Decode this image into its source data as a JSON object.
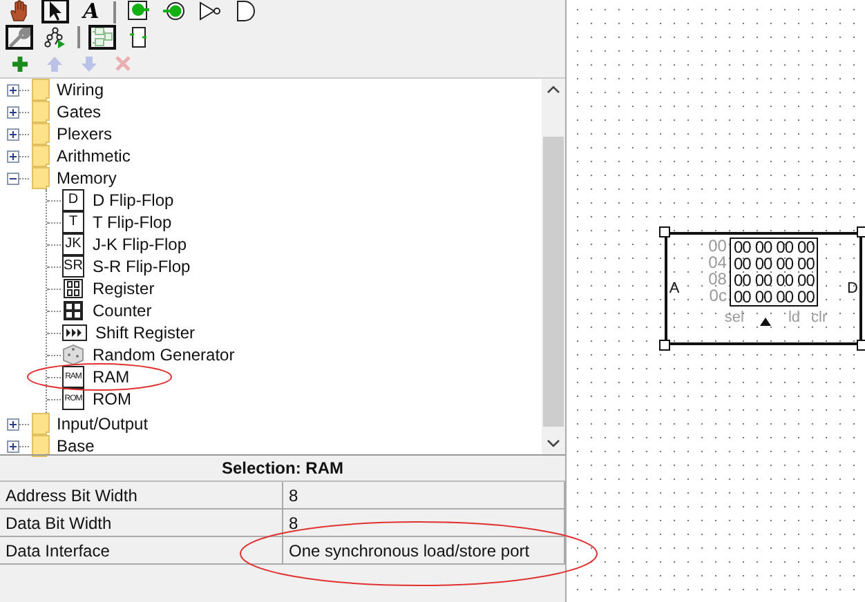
{
  "toolbar": [
    {
      "kind": "hand",
      "selected": false
    },
    {
      "kind": "arrow",
      "selected": true
    },
    {
      "kind": "text",
      "label": "A",
      "selected": false
    },
    {
      "kind": "separator"
    },
    {
      "kind": "input-pin",
      "selected": false
    },
    {
      "kind": "output-pin",
      "selected": false
    },
    {
      "kind": "not-gate",
      "selected": false
    },
    {
      "kind": "and-gate",
      "selected": false
    }
  ],
  "view_toolbar": [
    {
      "kind": "wrench",
      "selected": true
    },
    {
      "kind": "tree",
      "selected": false
    },
    {
      "kind": "separator"
    },
    {
      "kind": "layout",
      "selected": true
    },
    {
      "kind": "box",
      "selected": false
    }
  ],
  "explorer_toolbar": [
    {
      "kind": "add",
      "disabled": false
    },
    {
      "kind": "up",
      "disabled": true
    },
    {
      "kind": "down",
      "disabled": true
    },
    {
      "kind": "delete",
      "disabled": true
    }
  ],
  "tree": [
    {
      "label": "Wiring",
      "kind": "folder",
      "expanded": false
    },
    {
      "label": "Gates",
      "kind": "folder",
      "expanded": false
    },
    {
      "label": "Plexers",
      "kind": "folder",
      "expanded": false
    },
    {
      "label": "Arithmetic",
      "kind": "folder",
      "expanded": false
    },
    {
      "label": "Memory",
      "kind": "folder",
      "expanded": true,
      "children": [
        {
          "label": "D Flip-Flop",
          "kind": "letter",
          "badge": "D"
        },
        {
          "label": "T Flip-Flop",
          "kind": "letter",
          "badge": "T"
        },
        {
          "label": "J-K Flip-Flop",
          "kind": "letter",
          "badge": "JK"
        },
        {
          "label": "S-R Flip-Flop",
          "kind": "letter",
          "badge": "SR"
        },
        {
          "label": "Register",
          "kind": "register"
        },
        {
          "label": "Counter",
          "kind": "counter"
        },
        {
          "label": "Shift Register",
          "kind": "shift-register"
        },
        {
          "label": "Random Generator",
          "kind": "dice"
        },
        {
          "label": "RAM",
          "kind": "letter",
          "badge": "RAM"
        },
        {
          "label": "ROM",
          "kind": "letter",
          "badge": "ROM"
        }
      ]
    },
    {
      "label": "Input/Output",
      "kind": "folder",
      "expanded": false
    },
    {
      "label": "Base",
      "kind": "folder",
      "expanded": false
    }
  ],
  "selection": {
    "title": "Selection: RAM",
    "attributes": [
      {
        "name": "Address Bit Width",
        "value": "8"
      },
      {
        "name": "Data Bit Width",
        "value": "8"
      },
      {
        "name": "Data Interface",
        "value": "One synchronous load/store port"
      }
    ]
  },
  "canvas": {
    "component": {
      "selected": true,
      "address_labels": [
        "00",
        "04",
        "08",
        "0c"
      ],
      "rows": [
        [
          "00",
          "00",
          "00",
          "00"
        ],
        [
          "00",
          "00",
          "00",
          "00"
        ],
        [
          "00",
          "00",
          "00",
          "00"
        ],
        [
          "00",
          "00",
          "00",
          "00"
        ]
      ],
      "left_pin": "A",
      "right_pin": "D",
      "bottom_pins": [
        "sel",
        "ld",
        "clr"
      ]
    }
  }
}
